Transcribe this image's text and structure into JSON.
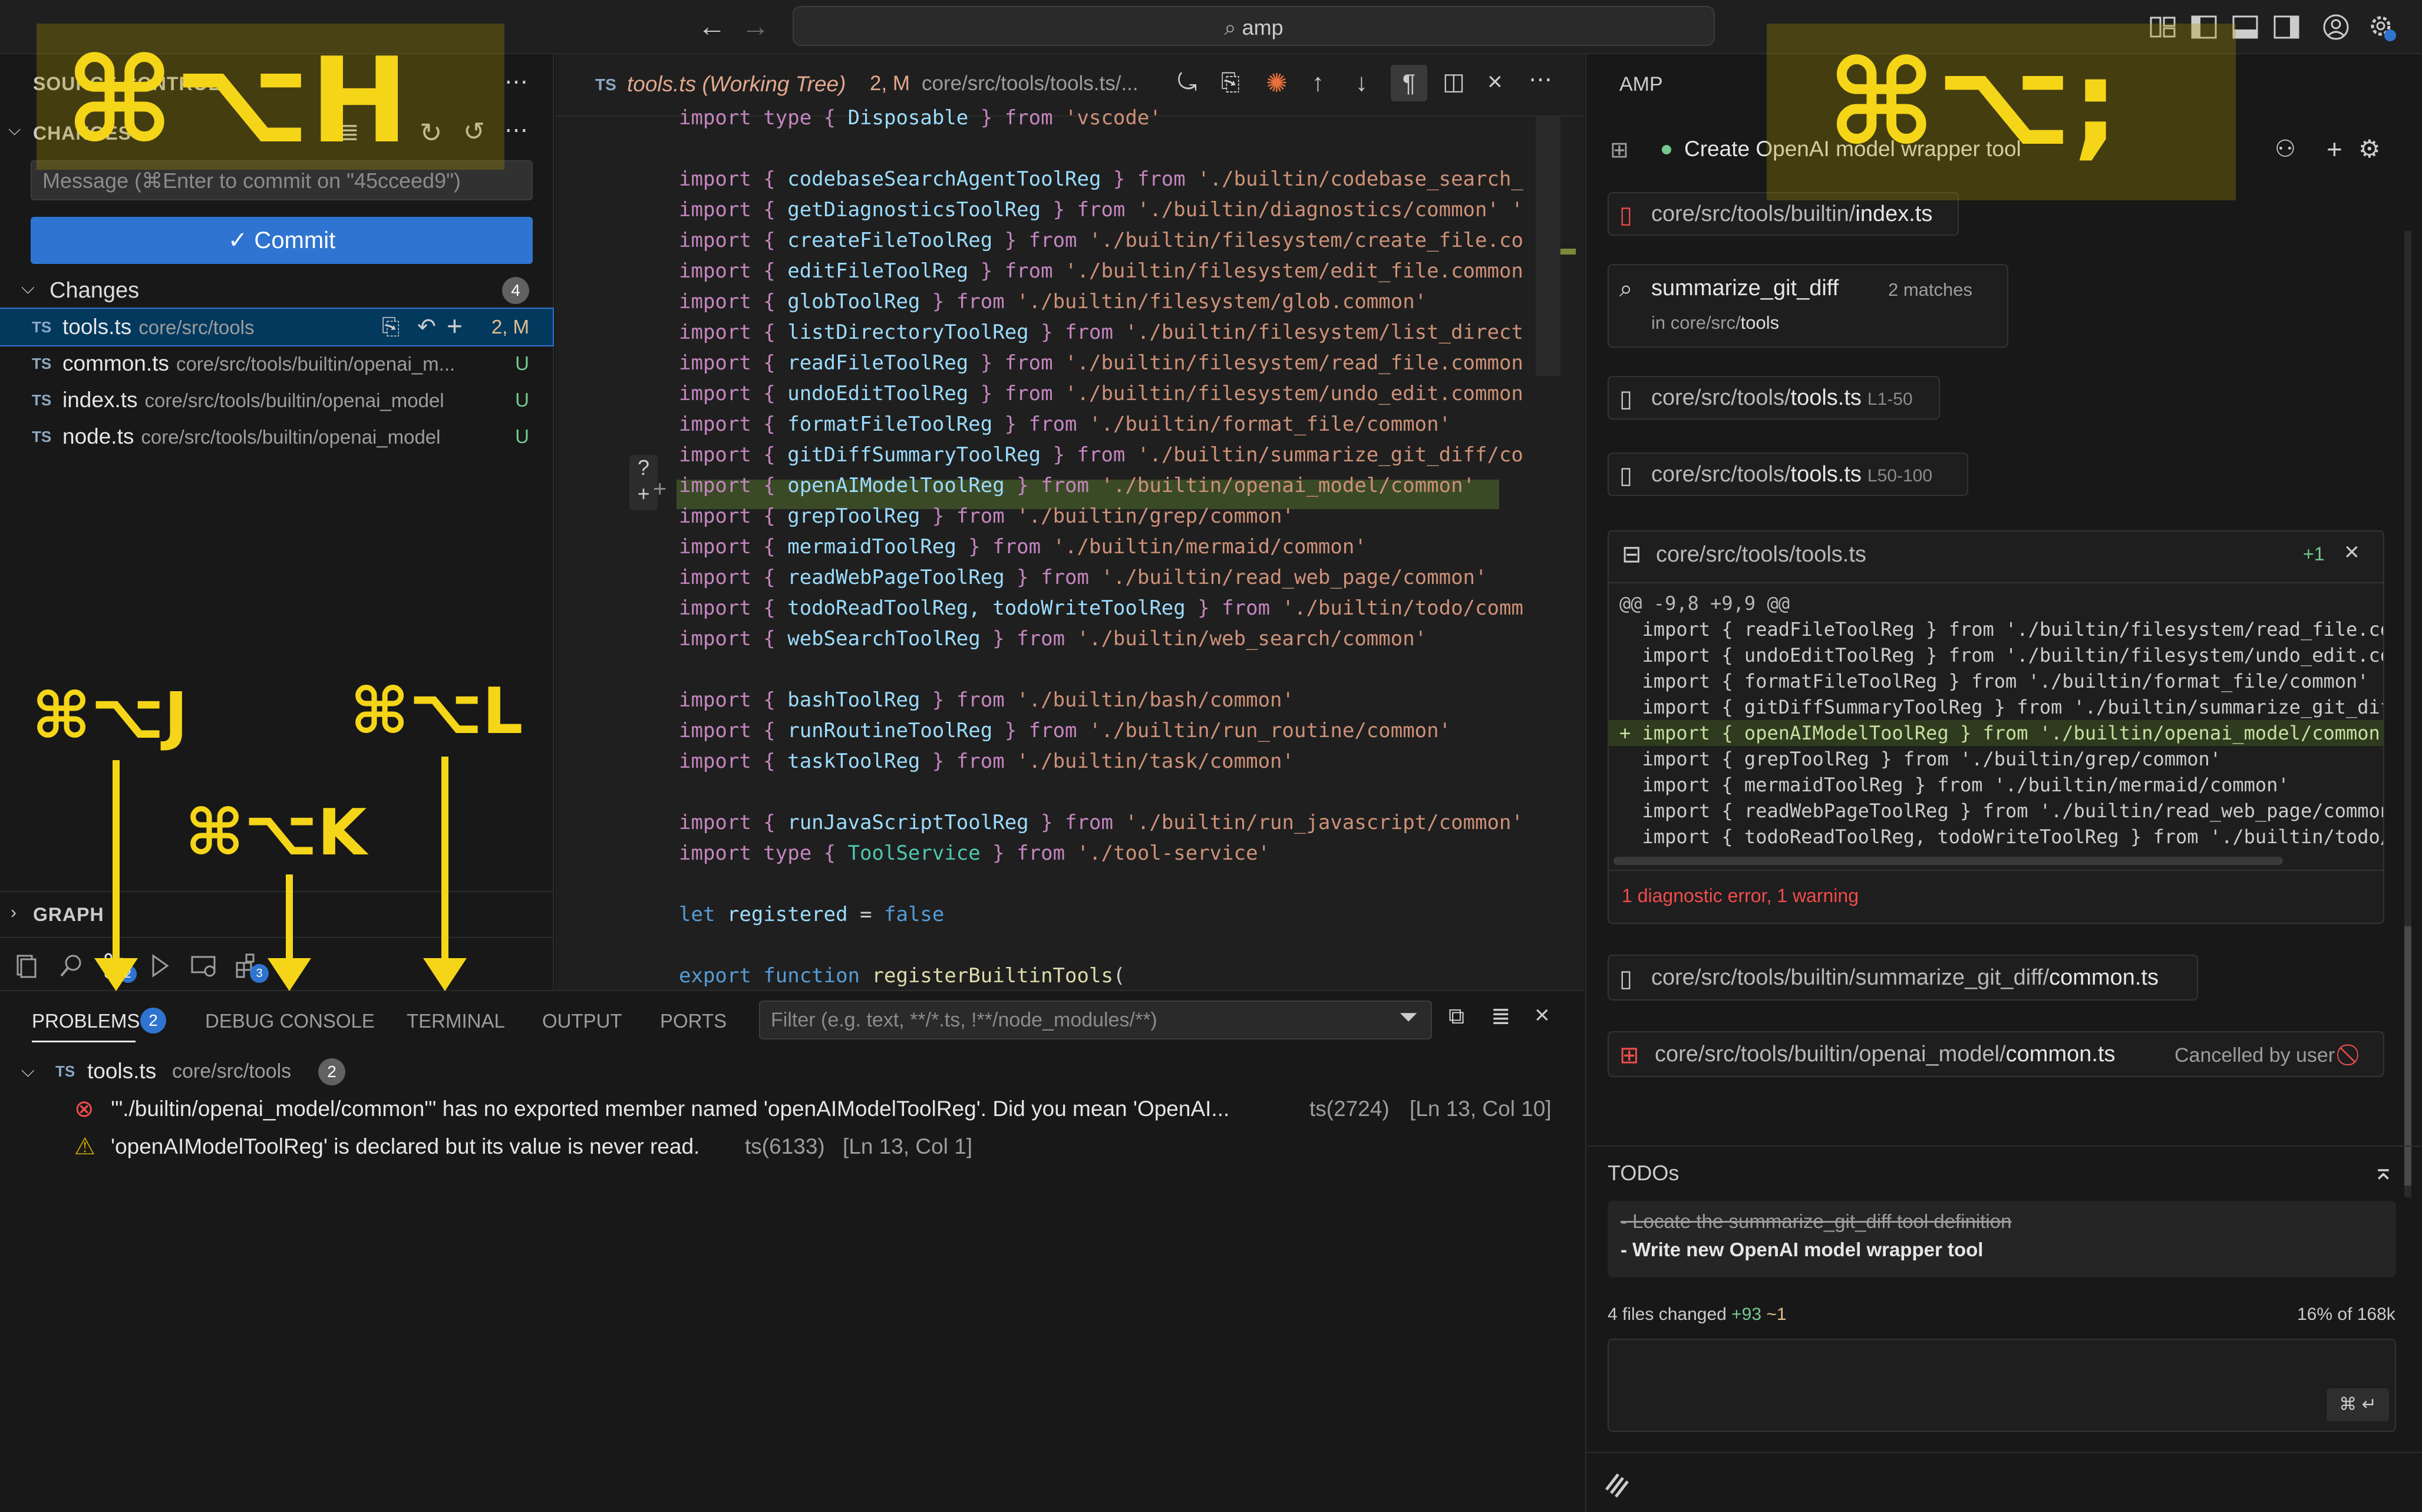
{
  "titlebar": {
    "search": "amp"
  },
  "source_control": {
    "title": "SOURCE CONTROL",
    "changes_header": "CHANGES",
    "message_placeholder": "Message (⌘Enter to commit on \"45cceed9\")",
    "commit_label": "✓ Commit",
    "changes_group": "Changes",
    "changes_count": "4",
    "files": [
      {
        "name": "tools.ts",
        "path": "core/src/tools",
        "status": "2, M"
      },
      {
        "name": "common.ts",
        "path": "core/src/tools/builtin/openai_m...",
        "status": "U"
      },
      {
        "name": "index.ts",
        "path": "core/src/tools/builtin/openai_model",
        "status": "U"
      },
      {
        "name": "node.ts",
        "path": "core/src/tools/builtin/openai_model",
        "status": "U"
      }
    ],
    "graph": "GRAPH",
    "activity_badges": {
      "scm": "2",
      "extensions": "3"
    }
  },
  "editor": {
    "tab_lang": "TS",
    "tab_title": "tools.ts (Working Tree)",
    "tab_status": "2, M",
    "tab_path": "core/src/tools/tools.ts/...",
    "lines": [
      {
        "pre": "import type { ",
        "name": "Disposable",
        "post": " } from ",
        "src": "'vscode'"
      },
      {
        "pre": "",
        "name": "",
        "post": "",
        "src": ""
      },
      {
        "pre": "import { ",
        "name": "codebaseSearchAgentToolReg",
        "post": " } from ",
        "src": "'./builtin/codebase_search_"
      },
      {
        "pre": "import { ",
        "name": "getDiagnosticsToolReg",
        "post": " } from ",
        "src": "'./builtin/diagnostics/common' '"
      },
      {
        "pre": "import { ",
        "name": "createFileToolReg",
        "post": " } from ",
        "src": "'./builtin/filesystem/create_file.co"
      },
      {
        "pre": "import { ",
        "name": "editFileToolReg",
        "post": " } from ",
        "src": "'./builtin/filesystem/edit_file.common"
      },
      {
        "pre": "import { ",
        "name": "globToolReg",
        "post": " } from ",
        "src": "'./builtin/filesystem/glob.common'"
      },
      {
        "pre": "import { ",
        "name": "listDirectoryToolReg",
        "post": " } from ",
        "src": "'./builtin/filesystem/list_direct"
      },
      {
        "pre": "import { ",
        "name": "readFileToolReg",
        "post": " } from ",
        "src": "'./builtin/filesystem/read_file.common"
      },
      {
        "pre": "import { ",
        "name": "undoEditToolReg",
        "post": " } from ",
        "src": "'./builtin/filesystem/undo_edit.common"
      },
      {
        "pre": "import { ",
        "name": "formatFileToolReg",
        "post": " } from ",
        "src": "'./builtin/format_file/common'"
      },
      {
        "pre": "import { ",
        "name": "gitDiffSummaryToolReg",
        "post": " } from ",
        "src": "'./builtin/summarize_git_diff/co"
      },
      {
        "pre": "import { ",
        "name": "openAIModelToolReg",
        "post": " } from ",
        "src": "'./builtin/openai_model/common'"
      },
      {
        "pre": "import { ",
        "name": "grepToolReg",
        "post": " } from ",
        "src": "'./builtin/grep/common'"
      },
      {
        "pre": "import { ",
        "name": "mermaidToolReg",
        "post": " } from ",
        "src": "'./builtin/mermaid/common'"
      },
      {
        "pre": "import { ",
        "name": "readWebPageToolReg",
        "post": " } from ",
        "src": "'./builtin/read_web_page/common'"
      },
      {
        "pre": "import { ",
        "name": "todoReadToolReg, todoWriteToolReg",
        "post": " } from ",
        "src": "'./builtin/todo/comm"
      },
      {
        "pre": "import { ",
        "name": "webSearchToolReg",
        "post": " } from ",
        "src": "'./builtin/web_search/common'"
      },
      {
        "pre": "",
        "name": "",
        "post": "",
        "src": ""
      },
      {
        "pre": "import { ",
        "name": "bashToolReg",
        "post": " } from ",
        "src": "'./builtin/bash/common'"
      },
      {
        "pre": "import { ",
        "name": "runRoutineToolReg",
        "post": " } from ",
        "src": "'./builtin/run_routine/common'"
      },
      {
        "pre": "import { ",
        "name": "taskToolReg",
        "post": " } from ",
        "src": "'./builtin/task/common'"
      },
      {
        "pre": "",
        "name": "",
        "post": "",
        "src": ""
      },
      {
        "pre": "import { ",
        "name": "runJavaScriptToolReg",
        "post": " } from ",
        "src": "'./builtin/run_javascript/common'"
      },
      {
        "pre": "import type { ",
        "name": "ToolService",
        "post": " } from ",
        "src": "'./tool-service'"
      },
      {
        "pre": "",
        "name": "",
        "post": "",
        "src": ""
      },
      {
        "pre": "let ",
        "name": "registered",
        "post": " = ",
        "src": "false"
      },
      {
        "pre": "",
        "name": "",
        "post": "",
        "src": ""
      },
      {
        "pre": "export function ",
        "name": "registerBuiltinTools",
        "post": "(",
        "src": ""
      }
    ]
  },
  "panel": {
    "tabs": [
      "PROBLEMS",
      "DEBUG CONSOLE",
      "TERMINAL",
      "OUTPUT",
      "PORTS"
    ],
    "problems_count": "2",
    "filter_placeholder": "Filter (e.g. text, **/*.ts, !**/node_modules/**)",
    "file": {
      "name": "tools.ts",
      "path": "core/src/tools",
      "count": "2"
    },
    "problems": [
      {
        "message": "'\"./builtin/openai_model/common\"' has no exported member named 'openAIModelToolReg'. Did you mean 'OpenAI...",
        "code": "ts(2724)",
        "loc": "[Ln 13, Col 10]"
      },
      {
        "message": "'openAIModelToolReg' is declared but its value is never read.",
        "code": "ts(6133)",
        "loc": "[Ln 13, Col 1]"
      }
    ]
  },
  "amp": {
    "title": "AMP",
    "thread_title": "Create OpenAI model wrapper tool",
    "cards": {
      "index": {
        "dir": "core/src/tools/builtin/",
        "file": "index.ts"
      },
      "search": {
        "query": "summarize_git_diff",
        "matches": "2 matches",
        "in": "in core/src/",
        "in_dir": "tools"
      },
      "read1": {
        "dir": "core/src/tools/",
        "file": "tools.ts",
        "range": "L1-50"
      },
      "read2": {
        "dir": "core/src/tools/",
        "file": "tools.ts",
        "range": "L50-100"
      },
      "edit": {
        "path": "core/src/tools/tools.ts",
        "added": "+1"
      },
      "diff_header": "@@ -9,8 +9,9 @@",
      "diff_lines": [
        "  import { readFileToolReg } from './builtin/filesystem/read_file.co",
        "  import { undoEditToolReg } from './builtin/filesystem/undo_edit.co",
        "  import { formatFileToolReg } from './builtin/format_file/common'",
        "  import { gitDiffSummaryToolReg } from './builtin/summarize_git_dif",
        "+ import { openAIModelToolReg } from './builtin/openai_model/common'",
        "  import { grepToolReg } from './builtin/grep/common'",
        "  import { mermaidToolReg } from './builtin/mermaid/common'",
        "  import { readWebPageToolReg } from './builtin/read_web_page/common",
        "  import { todoReadToolReg, todoWriteToolReg } from './builtin/todo/"
      ],
      "diagnostic": "1 diagnostic error, 1 warning",
      "common": {
        "dir": "core/src/tools/builtin/summarize_git_diff/",
        "file": "common.ts"
      },
      "openai_common": {
        "dir": "core/src/tools/builtin/openai_model/",
        "file": "common.ts",
        "status": "Cancelled by user"
      }
    },
    "todos": {
      "title": "TODOs",
      "items": [
        {
          "text": "Locate the summarize_git_diff tool definition",
          "done": true
        },
        {
          "text": "Write new OpenAI model wrapper tool",
          "done": false
        }
      ]
    },
    "footer": {
      "changed": "4 files changed",
      "added": "+93",
      "modified": "~1",
      "context": "16% of 168k"
    },
    "submit_hint": "⌘ ↵"
  },
  "overlays": {
    "h": "⌘⌥H",
    "semicolon": "⌘⌥;",
    "j": "⌘⌥J",
    "k": "⌘⌥K",
    "l": "⌘⌥L"
  },
  "colors": {
    "accent": "#2f74d0",
    "overlay": "#f5d518",
    "added": "#73c991",
    "error": "#f14c4c",
    "warning": "#cca700"
  }
}
